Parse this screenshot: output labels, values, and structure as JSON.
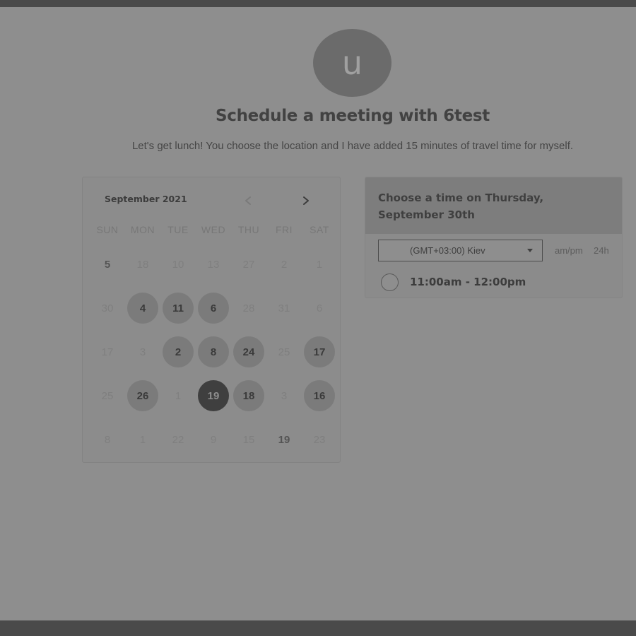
{
  "header": {
    "avatar_letter": "u",
    "title": "Schedule a meeting with 6test",
    "description": "Let's get lunch! You choose the location and I have added 15 minutes of travel time for myself."
  },
  "calendar": {
    "month_label": "September 2021",
    "weekdays": [
      "SUN",
      "MON",
      "TUE",
      "WED",
      "THU",
      "FRI",
      "SAT"
    ],
    "weeks": [
      [
        {
          "label": "5",
          "state": "plain"
        },
        {
          "label": "18",
          "state": "inactive"
        },
        {
          "label": "10",
          "state": "inactive"
        },
        {
          "label": "13",
          "state": "inactive"
        },
        {
          "label": "27",
          "state": "inactive"
        },
        {
          "label": "2",
          "state": "inactive"
        },
        {
          "label": "1",
          "state": "inactive"
        }
      ],
      [
        {
          "label": "30",
          "state": "inactive"
        },
        {
          "label": "4",
          "state": "available"
        },
        {
          "label": "11",
          "state": "available"
        },
        {
          "label": "6",
          "state": "available"
        },
        {
          "label": "28",
          "state": "inactive"
        },
        {
          "label": "31",
          "state": "inactive"
        },
        {
          "label": "6",
          "state": "inactive"
        }
      ],
      [
        {
          "label": "17",
          "state": "inactive"
        },
        {
          "label": "3",
          "state": "inactive"
        },
        {
          "label": "2",
          "state": "available"
        },
        {
          "label": "8",
          "state": "available"
        },
        {
          "label": "24",
          "state": "available"
        },
        {
          "label": "25",
          "state": "inactive"
        },
        {
          "label": "17",
          "state": "available"
        }
      ],
      [
        {
          "label": "25",
          "state": "inactive"
        },
        {
          "label": "26",
          "state": "available"
        },
        {
          "label": "1",
          "state": "inactive"
        },
        {
          "label": "19",
          "state": "selected"
        },
        {
          "label": "18",
          "state": "available"
        },
        {
          "label": "3",
          "state": "inactive"
        },
        {
          "label": "16",
          "state": "available"
        }
      ],
      [
        {
          "label": "8",
          "state": "inactive"
        },
        {
          "label": "1",
          "state": "inactive"
        },
        {
          "label": "22",
          "state": "inactive"
        },
        {
          "label": "9",
          "state": "inactive"
        },
        {
          "label": "15",
          "state": "inactive"
        },
        {
          "label": "19",
          "state": "plain"
        },
        {
          "label": "23",
          "state": "inactive"
        }
      ]
    ]
  },
  "time_panel": {
    "heading": "Choose a time on Thursday, September 30th",
    "timezone": "(GMT+03:00) Kiev",
    "format_ampm": "am/pm",
    "format_24h": "24h",
    "slots": [
      "11:00am - 12:00pm"
    ]
  },
  "icons": {
    "prev": "chevron-left-icon",
    "next": "chevron-right-icon",
    "dropdown": "caret-down-icon"
  }
}
